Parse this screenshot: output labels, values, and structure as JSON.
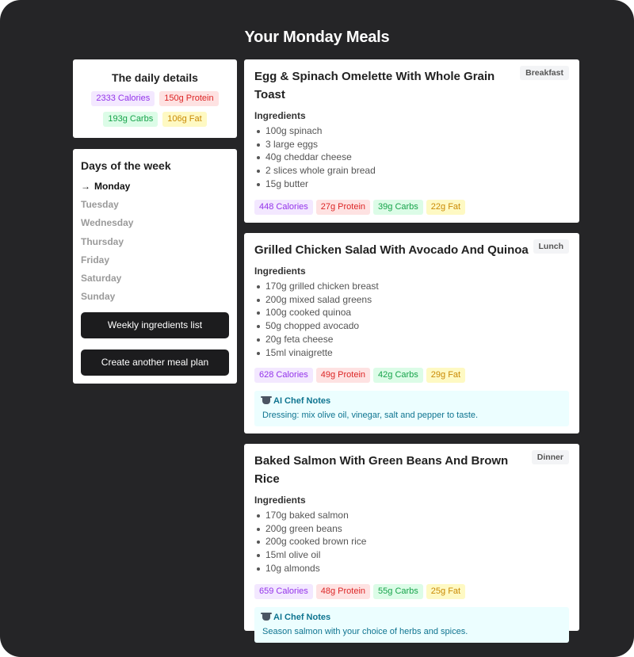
{
  "page": {
    "title": "Your Monday Meals"
  },
  "daily": {
    "title": "The daily details",
    "calories": "2333 Calories",
    "protein": "150g Protein",
    "carbs": "193g Carbs",
    "fat": "106g Fat"
  },
  "days": {
    "title": "Days of the week",
    "active_arrow": "→",
    "items": [
      "Monday",
      "Tuesday",
      "Wednesday",
      "Thursday",
      "Friday",
      "Saturday",
      "Sunday"
    ],
    "active": "Monday"
  },
  "actions": {
    "weekly": "Weekly ingredients list",
    "create": "Create another meal plan"
  },
  "meals": [
    {
      "title": "Egg & Spinach Omelette With Whole Grain Toast",
      "tag": "Breakfast",
      "ingredients_label": "Ingredients",
      "ingredients": [
        "100g spinach",
        "3 large eggs",
        "40g cheddar cheese",
        "2 slices whole grain bread",
        "15g butter"
      ],
      "calories": "448 Calories",
      "protein": "27g Protein",
      "carbs": "39g Carbs",
      "fat": "22g Fat"
    },
    {
      "title": "Grilled Chicken Salad With Avocado And Quinoa",
      "tag": "Lunch",
      "ingredients_label": "Ingredients",
      "ingredients": [
        "170g grilled chicken breast",
        "200g mixed salad greens",
        "100g cooked quinoa",
        "50g chopped avocado",
        "20g feta cheese",
        "15ml vinaigrette"
      ],
      "calories": "628 Calories",
      "protein": "49g Protein",
      "carbs": "42g Carbs",
      "fat": "29g Fat",
      "notes_title": "AI Chef Notes",
      "notes_text": "Dressing: mix olive oil, vinegar, salt and pepper to taste."
    },
    {
      "title": "Baked Salmon With Green Beans And Brown Rice",
      "tag": "Dinner",
      "ingredients_label": "Ingredients",
      "ingredients": [
        "170g baked salmon",
        "200g green beans",
        "200g cooked brown rice",
        "15ml olive oil",
        "10g almonds"
      ],
      "calories": "659 Calories",
      "protein": "48g Protein",
      "carbs": "55g Carbs",
      "fat": "25g Fat",
      "notes_title": "AI Chef Notes",
      "notes_text": "Season salmon with your choice of herbs and spices."
    }
  ]
}
